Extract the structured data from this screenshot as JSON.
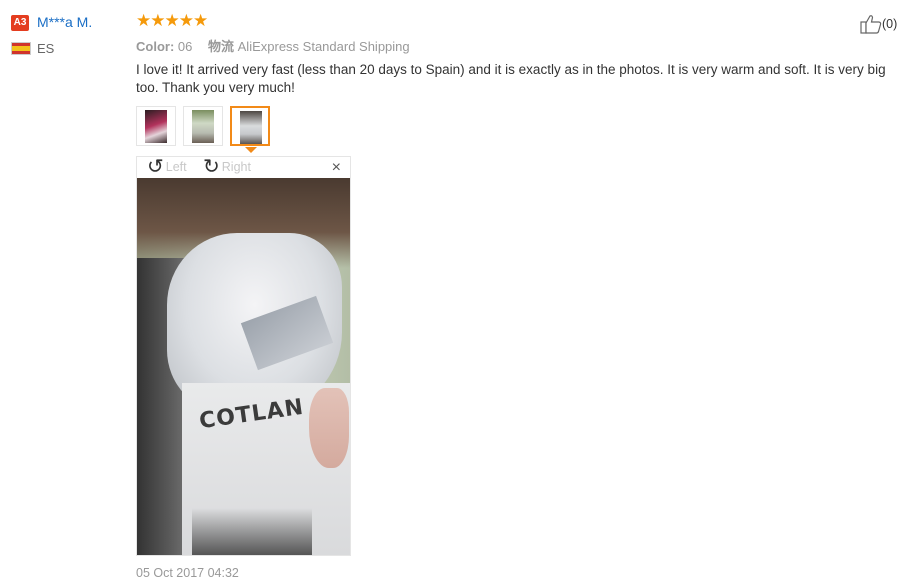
{
  "reviewer": {
    "level_badge": "A3",
    "name": "M***a M.",
    "country_code": "ES",
    "flag_icon": "spain-flag-icon"
  },
  "rating": {
    "stars": 5,
    "max": 5,
    "display": "★★★★★",
    "star_color": "#f59a0b"
  },
  "attributes": {
    "color_label": "Color:",
    "color_value": "06",
    "shipping_label": "物流",
    "shipping_value": "AliExpress Standard Shipping"
  },
  "review_text": "I love it! It arrived very fast (less than 20 days to Spain) and it is exactly as in the photos. It is very warm and soft. It is very big too. Thank you very much!",
  "thumbnails": [
    {
      "name": "photo-1",
      "selected": false
    },
    {
      "name": "photo-2",
      "selected": false
    },
    {
      "name": "photo-3",
      "selected": true
    }
  ],
  "viewer": {
    "rotate_left_label": "Left",
    "rotate_right_label": "Right",
    "close_label": "×",
    "photo_text": "COTLAN"
  },
  "date": "05 Oct 2017 04:32",
  "helpful": {
    "icon": "thumbs-up-icon",
    "count_text": "(0)"
  },
  "colors": {
    "accent": "#f28a18",
    "link": "#1a6ec5",
    "badge": "#e43d1f"
  }
}
